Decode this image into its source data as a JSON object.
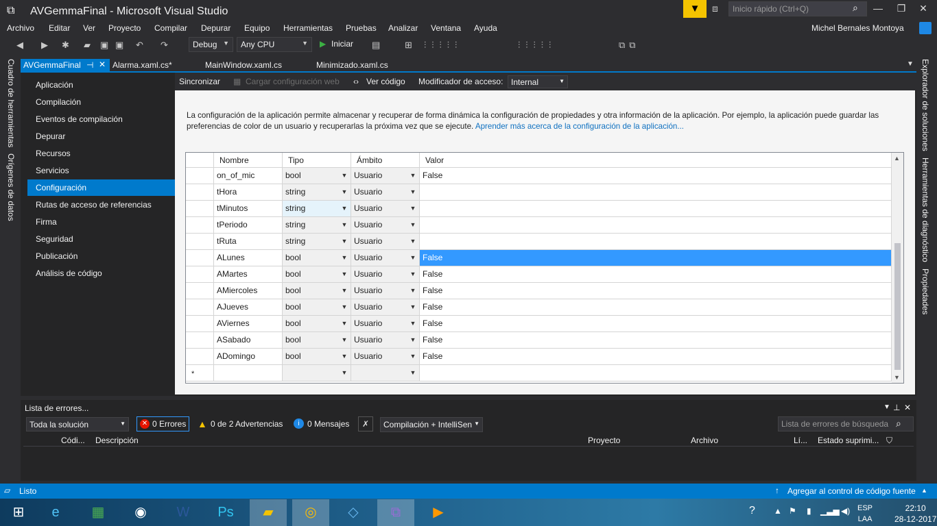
{
  "window": {
    "title": "AVGemmaFinal - Microsoft Visual Studio",
    "quick_launch_placeholder": "Inicio rápido (Ctrl+Q)"
  },
  "menu": [
    "Archivo",
    "Editar",
    "Ver",
    "Proyecto",
    "Compilar",
    "Depurar",
    "Equipo",
    "Herramientas",
    "Pruebas",
    "Analizar",
    "Ventana",
    "Ayuda"
  ],
  "user": {
    "name": "Michel Bernales Montoya"
  },
  "toolbar": {
    "config": "Debug",
    "platform": "Any CPU",
    "start": "Iniciar"
  },
  "left_rail": [
    "Cuadro de herramientas",
    "Orígenes de datos"
  ],
  "right_rail": [
    "Explorador de soluciones",
    "Herramientas de diagnóstico",
    "Propiedades"
  ],
  "tabs": [
    "AVGemmaFinal",
    "Alarma.xaml.cs*",
    "MainWindow.xaml.cs",
    "Minimizado.xaml.cs"
  ],
  "nav": [
    "Aplicación",
    "Compilación",
    "Eventos de compilación",
    "Depurar",
    "Recursos",
    "Servicios",
    "Configuración",
    "Rutas de acceso de referencias",
    "Firma",
    "Seguridad",
    "Publicación",
    "Análisis de código"
  ],
  "settings_toolbar": {
    "sync": "Sincronizar",
    "load_web": "Cargar configuración web",
    "view_code": "Ver código",
    "access_label": "Modificador de acceso:",
    "access_value": "Internal"
  },
  "description": {
    "text": "La configuración de la aplicación permite almacenar y recuperar de forma dinámica la configuración de propiedades y otra información de la aplicación. Por ejemplo, la aplicación puede guardar las preferencias de color de un usuario y recuperarlas la próxima vez que se ejecute.",
    "link": "Aprender más acerca de la configuración de la aplicación..."
  },
  "grid": {
    "headers": [
      "Nombre",
      "Tipo",
      "Ámbito",
      "Valor"
    ],
    "rows": [
      {
        "name": "on_of_mic",
        "type": "bool",
        "scope": "Usuario",
        "value": "False"
      },
      {
        "name": "tHora",
        "type": "string",
        "scope": "Usuario",
        "value": ""
      },
      {
        "name": "tMinutos",
        "type": "string",
        "scope": "Usuario",
        "value": ""
      },
      {
        "name": "tPeriodo",
        "type": "string",
        "scope": "Usuario",
        "value": ""
      },
      {
        "name": "tRuta",
        "type": "string",
        "scope": "Usuario",
        "value": ""
      },
      {
        "name": "ALunes",
        "type": "bool",
        "scope": "Usuario",
        "value": "False"
      },
      {
        "name": "AMartes",
        "type": "bool",
        "scope": "Usuario",
        "value": "False"
      },
      {
        "name": "AMiercoles",
        "type": "bool",
        "scope": "Usuario",
        "value": "False"
      },
      {
        "name": "AJueves",
        "type": "bool",
        "scope": "Usuario",
        "value": "False"
      },
      {
        "name": "AViernes",
        "type": "bool",
        "scope": "Usuario",
        "value": "False"
      },
      {
        "name": "ASabado",
        "type": "bool",
        "scope": "Usuario",
        "value": "False"
      },
      {
        "name": "ADomingo",
        "type": "bool",
        "scope": "Usuario",
        "value": "False"
      }
    ],
    "new_row_marker": "*"
  },
  "error_list": {
    "title": "Lista de errores...",
    "scope": "Toda la solución",
    "errors": "0 Errores",
    "warnings": "0 de 2 Advertencias",
    "messages": "0 Mensajes",
    "build_filter": "Compilación + IntelliSen",
    "search_placeholder": "Lista de errores de búsqueda",
    "columns": [
      "Códi...",
      "Descripción",
      "Proyecto",
      "Archivo",
      "Lí...",
      "Estado suprimi..."
    ]
  },
  "status": {
    "text": "Listo",
    "right": "Agregar al control de código fuente"
  },
  "taskbar": {
    "lang1": "ESP",
    "lang2": "LAA",
    "time": "22:10",
    "date": "28-12-2017"
  }
}
